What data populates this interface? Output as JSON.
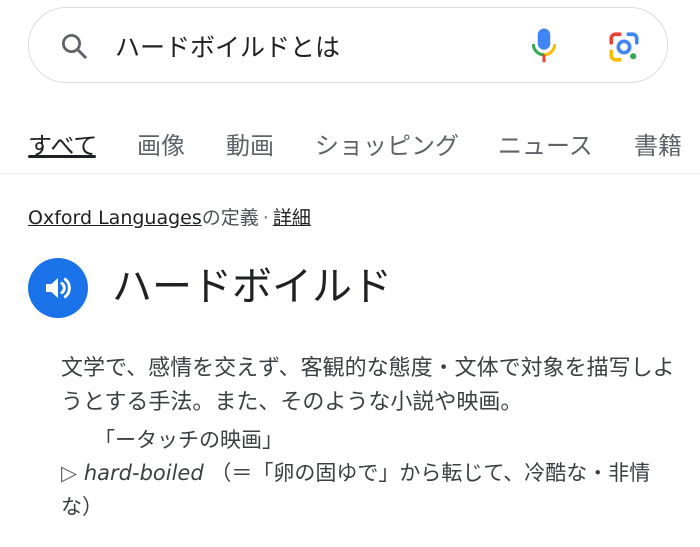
{
  "search": {
    "query": "ハードボイルドとは"
  },
  "tabs": [
    {
      "label": "すべて",
      "active": true
    },
    {
      "label": "画像"
    },
    {
      "label": "動画"
    },
    {
      "label": "ショッピング"
    },
    {
      "label": "ニュース"
    },
    {
      "label": "書籍"
    }
  ],
  "source": {
    "provider": "Oxford Languages",
    "suffix": "の定義",
    "separator": "·",
    "details_link": "詳細"
  },
  "entry": {
    "headword": "ハードボイルド",
    "definition": "文学で、感情を交えず、客観的な態度・文体で対象を描写しようとする手法。また、そのような小説や映画。",
    "example": "「ータッチの映画」",
    "etymology_marker": "▷",
    "etymology_word": "hard-boiled",
    "etymology_text": "（＝「卵の固ゆで」から転じて、冷酷な・非情な）"
  },
  "colors": {
    "accent_blue": "#1a73e8",
    "text_primary": "#202124",
    "text_secondary": "#5f6368"
  },
  "icons": [
    "search-icon",
    "mic-icon",
    "google-lens-icon",
    "speaker-icon"
  ]
}
